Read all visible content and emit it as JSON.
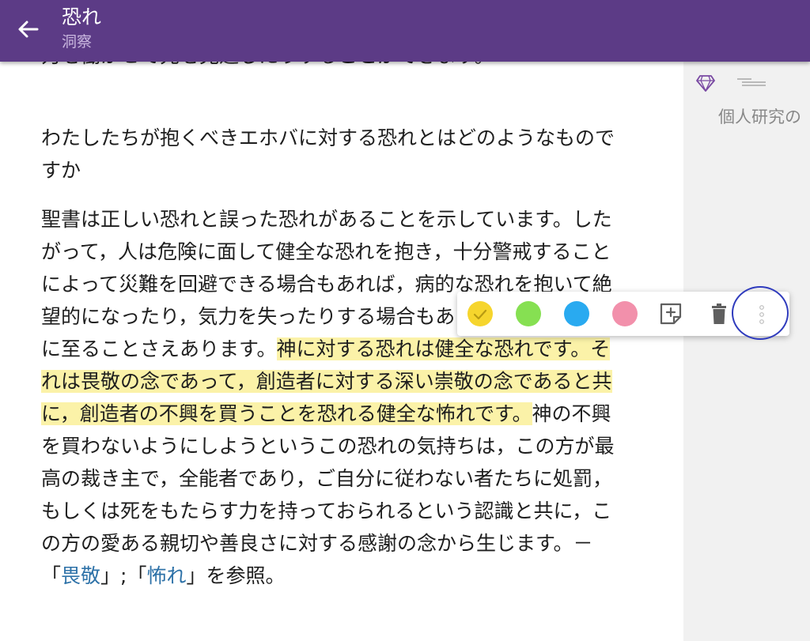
{
  "header": {
    "title": "恐れ",
    "subtitle": "洞察",
    "back_icon": "arrow-left-icon"
  },
  "article": {
    "cut_line": "力を働かせて先を見通したりすることができます。",
    "question": "わたしたちが抱くべきエホバに対する恐れとはどのようなものですか",
    "main_before": "聖書は正しい恐れと誤った恐れがあることを示しています。したがって，人は危険に面して健全な恐れを抱き，十分警戒することによって災難を回避できる場合もあれば，病的な恐れを抱いて絶望的になったり，気力を失ったりする場合もあり，そのために死に至ることさえあります。",
    "main_highlight": "神に対する恐れは健全な恐れです。それは畏敬の念であって，創造者に対する深い崇敬の念であると共に，創造者の不興を買うことを恐れる健全な怖れです。",
    "main_after": "神の不興を買わないようにしようというこの恐れの気持ちは，この方が最高の裁き主で，全能者であり，ご自分に従わない者たちに処罰，もしくは死をもたらす力を持っておられるという認識と共に，この方の愛ある親切や善良さに対する感謝の念から生じます。－「",
    "link1": "畏敬",
    "sep": "」;「",
    "link2": "怖れ",
    "end": "」を参照。"
  },
  "side_panel": {
    "label": "個人研究の",
    "icons": [
      "gem-icon",
      "lines-icon"
    ]
  },
  "highlight_toolbar": {
    "colors": {
      "yellow": "#f6d52d",
      "green": "#86e052",
      "blue": "#29aaf0",
      "pink": "#f290ab",
      "highlight_bg": "#fbf2a8",
      "appbar": "#5c3b86"
    },
    "selected": "yellow",
    "icons": [
      "check-icon",
      "add-note-icon",
      "trash-icon",
      "more-vertical-icon"
    ]
  }
}
